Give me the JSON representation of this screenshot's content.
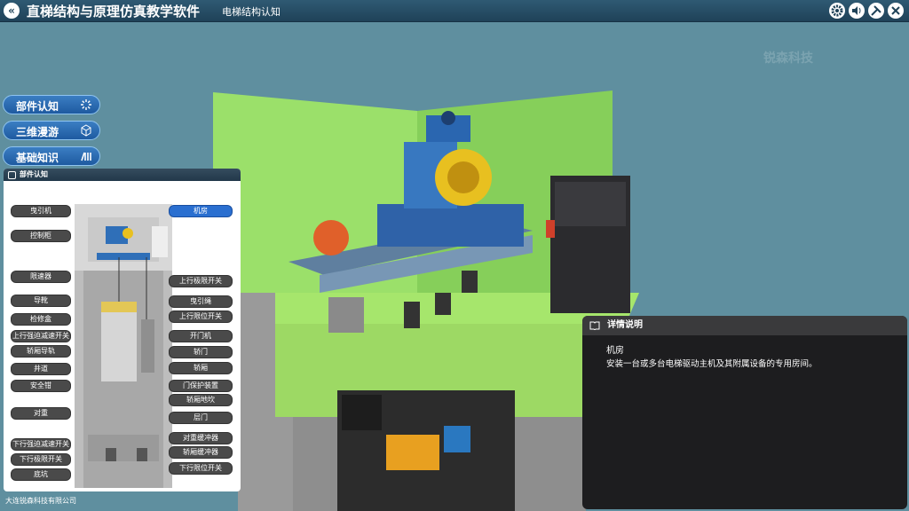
{
  "header": {
    "back_label": "«",
    "app_title": "直梯结构与原理仿真教学软件",
    "page_title": "电梯结构认知",
    "icons": [
      "gear-icon",
      "sound-icon",
      "tools-icon",
      "close-icon"
    ]
  },
  "menu": [
    {
      "label": "部件认知",
      "icon": "spinner-icon"
    },
    {
      "label": "三维漫游",
      "icon": "cube-icon"
    },
    {
      "label": "基础知识",
      "icon": "bars-icon"
    }
  ],
  "parts_panel": {
    "title": "部件认知",
    "left_labels": [
      "曳引机",
      "控制柜",
      "限速器",
      "导靴",
      "检修盒",
      "上行强迫减速开关",
      "轿厢导轨",
      "井道",
      "安全钳",
      "对重",
      "下行强迫减速开关",
      "下行极限开关",
      "底坑"
    ],
    "right_labels": [
      "机房",
      "上行极限开关",
      "曳引绳",
      "上行限位开关",
      "开门机",
      "轿门",
      "轿厢",
      "门保护装置",
      "轿厢地坎",
      "层门",
      "对重缓冲器",
      "轿厢缓冲器",
      "下行限位开关"
    ],
    "active_label": "机房"
  },
  "detail_panel": {
    "header": "详情说明",
    "title": "机房",
    "description": "安装一台或多台电梯驱动主机及其附属设备的专用房间。"
  },
  "watermark": "锐森科技",
  "footer": "大连锐森科技有限公司"
}
